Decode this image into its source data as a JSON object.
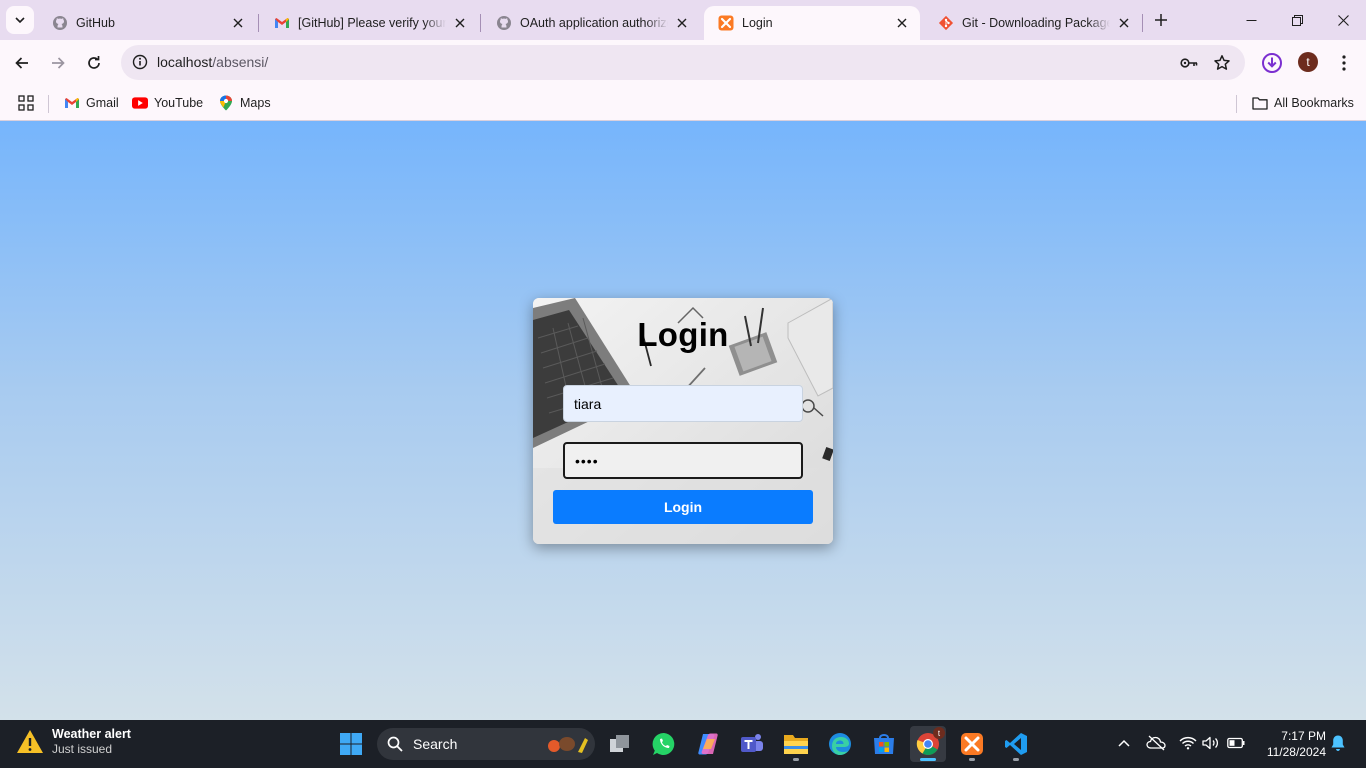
{
  "browser": {
    "tabs": [
      {
        "title": "GitHub",
        "icon": "github-icon",
        "active": false
      },
      {
        "title": "[GitHub] Please verify your device",
        "icon": "gmail-icon",
        "active": false
      },
      {
        "title": "OAuth application authorized",
        "icon": "github-icon",
        "active": false
      },
      {
        "title": "Login",
        "icon": "xampp-icon",
        "active": true
      },
      {
        "title": "Git - Downloading Package",
        "icon": "git-icon",
        "active": false
      }
    ],
    "url_host": "localhost",
    "url_path": "/absensi/",
    "profile_initial": "t",
    "bookmarks": [
      {
        "label": "Gmail",
        "icon": "gmail-icon"
      },
      {
        "label": "YouTube",
        "icon": "youtube-icon"
      },
      {
        "label": "Maps",
        "icon": "maps-icon"
      }
    ],
    "all_bookmarks_label": "All Bookmarks"
  },
  "page": {
    "title": "Login",
    "username_value": "tiara",
    "password_masked": "••••",
    "login_button": "Login"
  },
  "taskbar": {
    "weather_title": "Weather alert",
    "weather_subtitle": "Just issued",
    "search_label": "Search",
    "time": "7:17 PM",
    "date": "11/28/2024",
    "chrome_badge": "t"
  },
  "colors": {
    "accent_button": "#0a7cff",
    "page_gradient_top": "#76b5fc",
    "page_gradient_bottom": "#d3e1ea",
    "taskbar": "#1c2027"
  }
}
